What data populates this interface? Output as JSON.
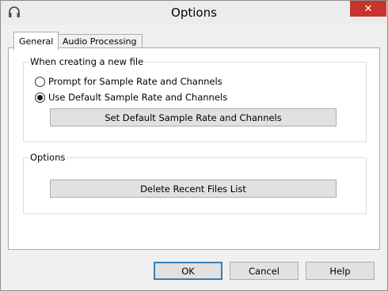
{
  "window": {
    "title": "Options",
    "close_label": "✕"
  },
  "tabs": [
    {
      "label": "General",
      "active": true
    },
    {
      "label": "Audio Processing",
      "active": false
    }
  ],
  "new_file_group": {
    "legend": "When creating a new file",
    "options": [
      {
        "label": "Prompt for Sample Rate and Channels",
        "selected": false
      },
      {
        "label": "Use Default Sample Rate and Channels",
        "selected": true
      }
    ],
    "set_default_button": "Set Default Sample Rate and Channels"
  },
  "options_group": {
    "legend": "Options",
    "delete_recent_button": "Delete Recent Files List"
  },
  "footer": {
    "ok_label": "OK",
    "cancel_label": "Cancel",
    "help_label": "Help"
  }
}
